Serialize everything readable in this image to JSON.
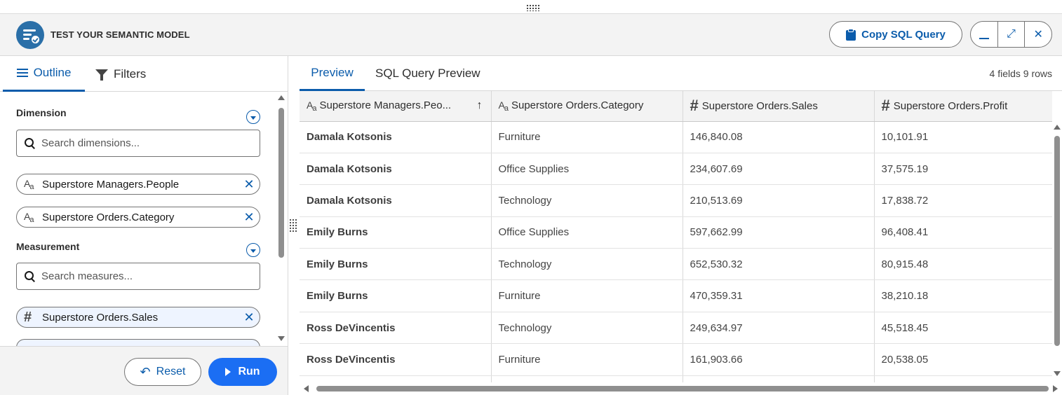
{
  "header": {
    "title": "TEST YOUR SEMANTIC MODEL",
    "copy_sql_label": "Copy SQL Query",
    "minimize_icon": "minimize-icon",
    "expand_icon": "expand-icon",
    "close_icon": "close-icon"
  },
  "left_panel": {
    "tabs": [
      {
        "label": "Outline",
        "icon": "list-icon",
        "active": true
      },
      {
        "label": "Filters",
        "icon": "funnel-icon",
        "active": false
      }
    ],
    "dimension": {
      "label": "Dimension",
      "search_placeholder": "Search dimensions...",
      "fields": [
        {
          "type_icon": "text-type-icon",
          "label": "Superstore Managers.People"
        },
        {
          "type_icon": "text-type-icon",
          "label": "Superstore Orders.Category"
        }
      ]
    },
    "measurement": {
      "label": "Measurement",
      "search_placeholder": "Search measures...",
      "fields": [
        {
          "type_icon": "number-type-icon",
          "label": "Superstore Orders.Sales"
        }
      ]
    },
    "reset_label": "Reset",
    "run_label": "Run"
  },
  "right_panel": {
    "tabs": [
      {
        "label": "Preview",
        "active": true
      },
      {
        "label": "SQL Query Preview",
        "active": false
      }
    ],
    "summary": "4 fields 9 rows",
    "columns": [
      {
        "type": "Aa",
        "label": "Superstore Managers.Peo...",
        "sorted": "asc"
      },
      {
        "type": "Aa",
        "label": "Superstore Orders.Category"
      },
      {
        "type": "#",
        "label": "Superstore Orders.Sales"
      },
      {
        "type": "#",
        "label": "Superstore Orders.Profit"
      }
    ],
    "rows": [
      [
        "Damala Kotsonis",
        "Furniture",
        "146,840.08",
        "10,101.91"
      ],
      [
        "Damala Kotsonis",
        "Office Supplies",
        "234,607.69",
        "37,575.19"
      ],
      [
        "Damala Kotsonis",
        "Technology",
        "210,513.69",
        "17,838.72"
      ],
      [
        "Emily Burns",
        "Office Supplies",
        "597,662.99",
        "96,408.41"
      ],
      [
        "Emily Burns",
        "Technology",
        "652,530.32",
        "80,915.48"
      ],
      [
        "Emily Burns",
        "Furniture",
        "470,359.31",
        "38,210.18"
      ],
      [
        "Ross DeVincentis",
        "Technology",
        "249,634.97",
        "45,518.45"
      ],
      [
        "Ross DeVincentis",
        "Furniture",
        "161,903.66",
        "20,538.05"
      ],
      [
        "",
        "",
        "",
        ""
      ]
    ]
  },
  "colors": {
    "accent": "#0b5cab",
    "run_button": "#1b6ef3",
    "header_bg": "#f3f3f3"
  }
}
